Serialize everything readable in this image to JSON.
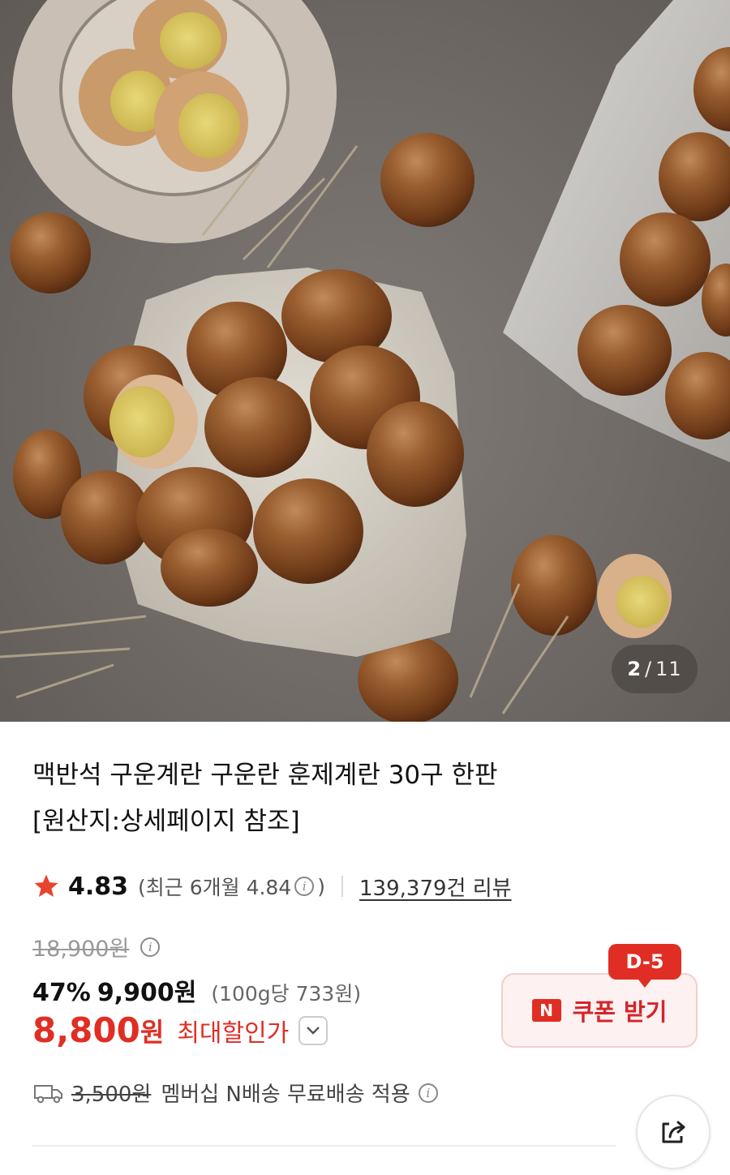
{
  "hero": {
    "counter_current": "2",
    "counter_separator": "/",
    "counter_total": "11"
  },
  "product": {
    "title_line1": "맥반석 구운계란 구운란 훈제계란 30구 한판",
    "title_line2": "[원산지:상세페이지 참조]",
    "rating": "4.83",
    "recent_rating_prefix": "(최근 6개월 4.84",
    "recent_rating_suffix": ")",
    "review_count": "139,379건 리뷰",
    "original_price": "18,900원",
    "discount_percent": "47%",
    "sale_price": "9,900원",
    "unit_price": "(100g당 733원)",
    "max_discount_price": "8,800",
    "max_discount_won": "원",
    "max_discount_label": "최대할인가"
  },
  "coupon": {
    "d_day": "D-5",
    "badge": "N",
    "label": "쿠폰 받기"
  },
  "delivery": {
    "original_fee": "3,500원",
    "text": "멤버십 N배송 무료배송 적용"
  },
  "colors": {
    "accent_red": "#e02e24",
    "coupon_bg": "#fdf1f1",
    "star": "#e8442d"
  },
  "icons": [
    "star-icon",
    "info-icon",
    "chevron-down-icon",
    "n-logo-icon",
    "truck-icon",
    "share-icon"
  ]
}
